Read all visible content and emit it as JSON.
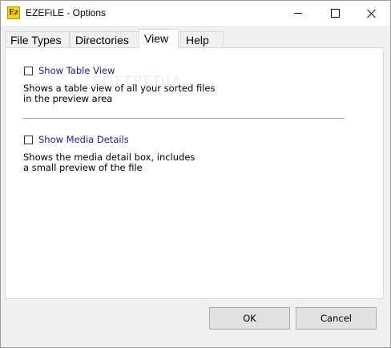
{
  "window": {
    "title": "EZEFiLE - Options",
    "icon_text": "Ez"
  },
  "title_controls": {
    "minimize": "minimize-icon",
    "maximize": "maximize-icon",
    "close": "close-icon"
  },
  "tabs": [
    {
      "label": "File Types",
      "active": false
    },
    {
      "label": "Directories",
      "active": false
    },
    {
      "label": "View",
      "active": true
    },
    {
      "label": "Help",
      "active": false
    }
  ],
  "view_panel": {
    "watermark": "SOFTPEDIA",
    "show_table_view": {
      "label": "Show Table View",
      "checked": false,
      "desc_line1": "Shows a table view of all your sorted files",
      "desc_line2": "in the preview area"
    },
    "show_media_details": {
      "label": "Show Media Details",
      "checked": false,
      "desc_line1": "Shows the media detail box, includes",
      "desc_line2": "a small preview of the file"
    }
  },
  "buttons": {
    "ok": "OK",
    "cancel": "Cancel"
  },
  "colors": {
    "label_text": "#1a1a8c",
    "panel_bg": "#ffffff",
    "dialog_bg": "#f0f0f0",
    "button_bg": "#e1e1e1"
  }
}
